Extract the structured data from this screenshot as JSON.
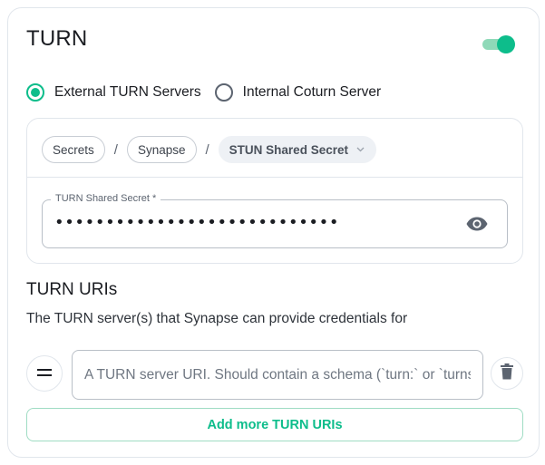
{
  "header": {
    "title": "TURN",
    "toggle_enabled": true
  },
  "colors": {
    "accent": "#0dbd8b",
    "accent_light": "#8fd9b8",
    "border": "#e1e6ec"
  },
  "server_mode": {
    "options": [
      {
        "label": "External TURN Servers",
        "selected": true
      },
      {
        "label": "Internal Coturn Server",
        "selected": false
      }
    ]
  },
  "secret": {
    "breadcrumbs": [
      "Secrets",
      "Synapse",
      "STUN Shared Secret"
    ],
    "separator": "/",
    "field_label": "TURN Shared Secret *",
    "masked_value": "••••••••••••••••••••••••••••",
    "visibility_icon": "eye-icon"
  },
  "uris": {
    "title": "TURN URIs",
    "description": "The TURN server(s) that Synapse can provide credentials for",
    "input_placeholder": "A TURN server URI. Should contain a schema (`turn:` or `turns:`)",
    "input_value": "",
    "drag_icon": "drag-handle-icon",
    "delete_icon": "trash-icon",
    "add_label": "Add more TURN URIs"
  }
}
